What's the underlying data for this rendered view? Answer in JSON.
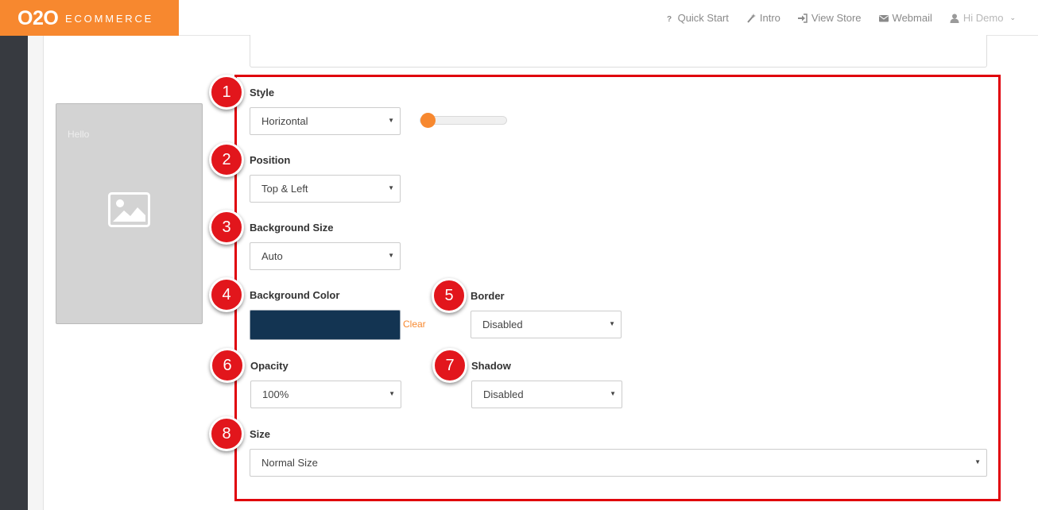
{
  "brand": {
    "logo_main": "O2O",
    "logo_sub": "ECOMMERCE",
    "accent": "#f7882f"
  },
  "nav": [
    {
      "icon": "question-icon",
      "label": "Quick Start"
    },
    {
      "icon": "magic-wand-icon",
      "label": "Intro"
    },
    {
      "icon": "sign-in-icon",
      "label": "View Store"
    },
    {
      "icon": "envelope-icon",
      "label": "Webmail"
    },
    {
      "icon": "user-icon",
      "label": "Hi Demo"
    }
  ],
  "preview": {
    "text": "Hello",
    "icon": "image-placeholder-icon"
  },
  "highlight_color": "#e0000b",
  "fields": {
    "style": {
      "badge": "1",
      "label": "Style",
      "value": "Horizontal",
      "slider_value": 0
    },
    "position": {
      "badge": "2",
      "label": "Position",
      "value": "Top & Left"
    },
    "background_size": {
      "badge": "3",
      "label": "Background Size",
      "value": "Auto"
    },
    "background_color": {
      "badge": "4",
      "label": "Background Color",
      "color": "#133452",
      "clear_label": "Clear"
    },
    "border": {
      "badge": "5",
      "label": "Border",
      "value": "Disabled"
    },
    "opacity": {
      "badge": "6",
      "label": "Opacity",
      "value": "100%"
    },
    "shadow": {
      "badge": "7",
      "label": "Shadow",
      "value": "Disabled"
    },
    "size": {
      "badge": "8",
      "label": "Size",
      "value": "Normal Size"
    }
  }
}
